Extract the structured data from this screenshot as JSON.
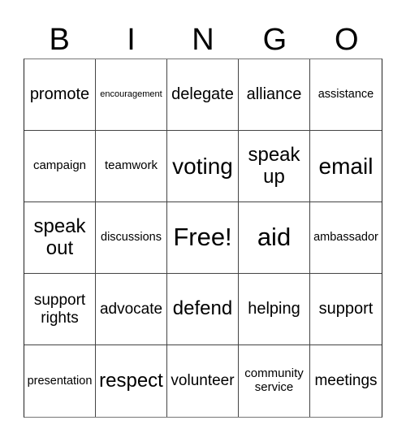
{
  "header": {
    "letters": [
      "B",
      "I",
      "N",
      "G",
      "O"
    ]
  },
  "board": {
    "rows": [
      [
        "promote",
        "encouragement",
        "delegate",
        "alliance",
        "assistance"
      ],
      [
        "campaign",
        "teamwork",
        "voting",
        "speak\nup",
        "email"
      ],
      [
        "speak\nout",
        "discussions",
        "Free!",
        "aid",
        "ambassador"
      ],
      [
        "support\nrights",
        "advocate",
        "defend",
        "helping",
        "support"
      ],
      [
        "presentation",
        "respect",
        "volunteer",
        "community\nservice",
        "meetings"
      ]
    ]
  }
}
